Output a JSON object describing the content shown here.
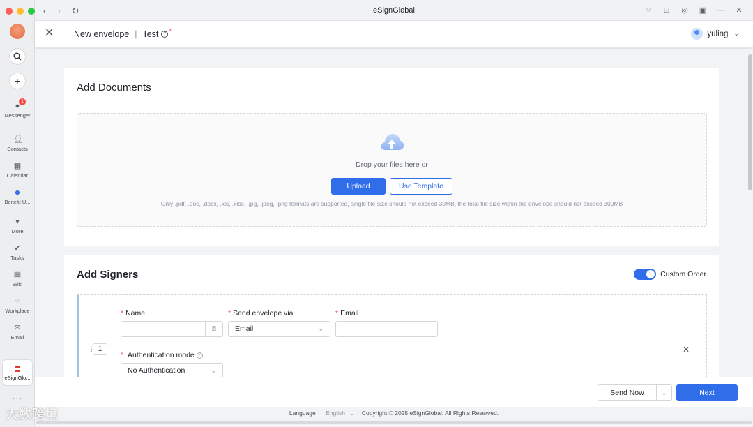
{
  "browser": {
    "title": "eSignGlobal",
    "nav": {
      "back": "‹",
      "forward": "›",
      "reload": "↻"
    },
    "tools": [
      "chat-icon",
      "robot-icon",
      "compass-icon",
      "window-icon",
      "more-icon",
      "close-icon"
    ]
  },
  "rail": {
    "items": [
      {
        "label": "Messenger",
        "badge": "1"
      },
      {
        "label": "Contacts"
      },
      {
        "label": "Calendar"
      },
      {
        "label": "Benefit U..."
      },
      {
        "label": "More"
      },
      {
        "label": "Tasks"
      },
      {
        "label": "Wiki"
      },
      {
        "label": "Workplace"
      },
      {
        "label": "Email"
      }
    ],
    "active_app": "eSignGlo..."
  },
  "header": {
    "title": "New envelope",
    "envelope_name": "Test",
    "user": "yuling"
  },
  "documents": {
    "heading": "Add Documents",
    "drop_text": "Drop your files here or",
    "upload_label": "Upload File",
    "template_label": "Use Template",
    "hint": "Only .pdf, .doc, .docx, .xls, .xlsx, .jpg, .jpeg, .png formats are supported, single file size should not exceed 30MB, the total file size within the envelope should not exceed 300MB"
  },
  "signers": {
    "heading": "Add Signers",
    "custom_order_label": "Custom Order",
    "custom_order_on": true,
    "row": {
      "index": "1",
      "name_label": "Name",
      "name_value": "",
      "via_label": "Send envelope via",
      "via_value": "Email",
      "email_label": "Email",
      "email_value": "",
      "auth_label": "Authentication mode",
      "auth_value": "No Authentication"
    }
  },
  "actions": {
    "send_now": "Send Now",
    "next": "Next"
  },
  "footer": {
    "language_label": "Language",
    "language_value": "English",
    "copyright": "Copyright © 2025 eSignGlobal. All Rights Reserved."
  },
  "watermark": "大数跨境",
  "colors": {
    "primary": "#2f6ee8",
    "required": "#f54a45",
    "signer_accent": "#9fc3e9"
  }
}
